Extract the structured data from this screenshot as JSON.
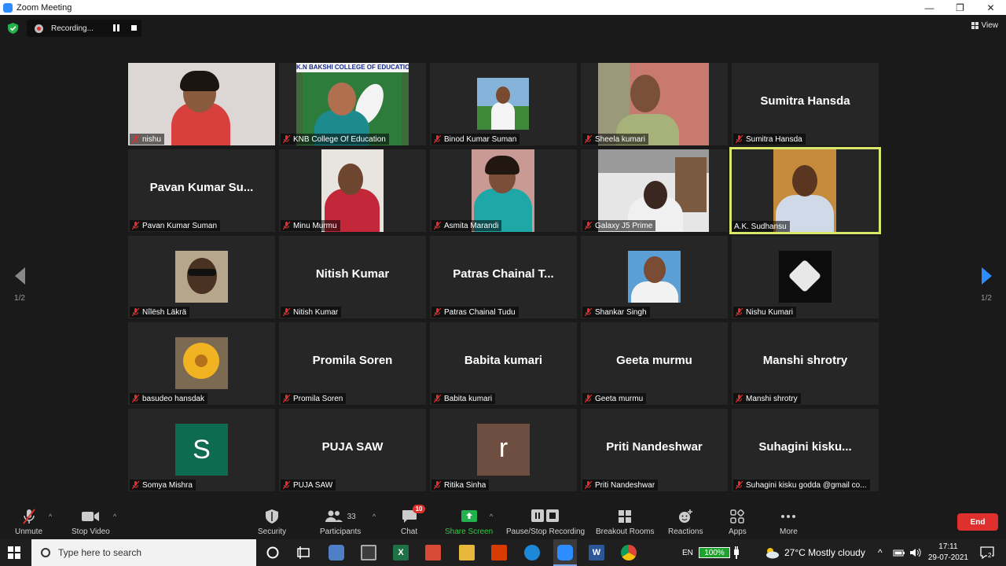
{
  "window": {
    "title": "Zoom Meeting",
    "controls": [
      "—",
      "❐",
      "✕"
    ]
  },
  "recording": {
    "label": "Recording..."
  },
  "view": {
    "label": "View"
  },
  "pager": {
    "left": "1/2",
    "right": "1/2"
  },
  "tiles": [
    {
      "label": "nishu",
      "big": ""
    },
    {
      "label": "KNB College Of Education",
      "big": "",
      "banner": "K.N BAKSHI COLLEGE OF EDUCATION"
    },
    {
      "label": "Binod Kumar Suman",
      "big": ""
    },
    {
      "label": "Sheela kumari",
      "big": ""
    },
    {
      "label": "Sumitra Hansda",
      "big": "Sumitra Hansda"
    },
    {
      "label": "Pavan Kumar Suman",
      "big": "Pavan Kumar Su..."
    },
    {
      "label": "Minu Murmu",
      "big": ""
    },
    {
      "label": "Asmita Marandi",
      "big": ""
    },
    {
      "label": "Galaxy J5 Prime",
      "big": ""
    },
    {
      "label": "A.K. Sudhansu",
      "big": ""
    },
    {
      "label": "Ñîlësh Läkrä",
      "big": ""
    },
    {
      "label": "Nitish Kumar",
      "big": "Nitish Kumar"
    },
    {
      "label": "Patras Chainal Tudu",
      "big": "Patras Chainal T..."
    },
    {
      "label": "Shankar Singh",
      "big": ""
    },
    {
      "label": "Nishu Kumari",
      "big": ""
    },
    {
      "label": "basudeo hansdak",
      "big": ""
    },
    {
      "label": "Promila Soren",
      "big": "Promila Soren"
    },
    {
      "label": "Babita kumari",
      "big": "Babita kumari"
    },
    {
      "label": "Geeta murmu",
      "big": "Geeta murmu"
    },
    {
      "label": "Manshi shrotry",
      "big": "Manshi shrotry"
    },
    {
      "label": "Somya Mishra",
      "big": "",
      "avatar": "S"
    },
    {
      "label": "PUJA SAW",
      "big": "PUJA SAW"
    },
    {
      "label": "Ritika Sinha",
      "big": "",
      "avatar": "r"
    },
    {
      "label": "Priti Nandeshwar",
      "big": "Priti Nandeshwar"
    },
    {
      "label": "Suhagini kisku godda  @gmail co...",
      "big": "Suhagini  kisku..."
    }
  ],
  "toolbar": {
    "unmute": "Unmute",
    "stop_video": "Stop Video",
    "security": "Security",
    "participants": "Participants",
    "participants_count": "33",
    "chat": "Chat",
    "chat_badge": "10",
    "share_screen": "Share Screen",
    "pause_stop_recording": "Pause/Stop Recording",
    "breakout_rooms": "Breakout Rooms",
    "reactions": "Reactions",
    "apps": "Apps",
    "more": "More",
    "end": "End"
  },
  "taskbar": {
    "search_placeholder": "Type here to search",
    "lang": "EN",
    "battery": "100%",
    "weather": "27°C  Mostly cloudy",
    "time": "17:11",
    "date": "29-07-2021",
    "notifications": "2"
  },
  "colors": {
    "accent": "#2d8cff",
    "end": "#e0302d",
    "active_border": "#d9e86a",
    "share_green": "#2ecc40"
  }
}
